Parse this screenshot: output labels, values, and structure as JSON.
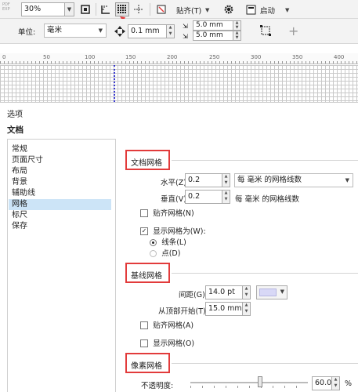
{
  "toolbar1": {
    "zoom_value": "30%",
    "snap_label": "贴齐(T)",
    "launch_label": "启动"
  },
  "toolbar2": {
    "unit_label": "单位:",
    "unit_value": "毫米",
    "nudge_value": "0.1 mm",
    "dup_h_value": "5.0 mm",
    "dup_v_value": "5.0 mm",
    "add_symbol": "+"
  },
  "ruler": {
    "ticks": [
      "0",
      "50",
      "100",
      "150",
      "200",
      "250",
      "300",
      "350",
      "400"
    ]
  },
  "dialog": {
    "title": "选项",
    "section": "文档"
  },
  "tree": {
    "items": [
      "常规",
      "页面尺寸",
      "布局",
      "背景",
      "辅助线",
      "网格",
      "标尺",
      "保存"
    ],
    "selected": "网格"
  },
  "document_grid": {
    "heading": "文档网格",
    "h_label": "水平(Z):",
    "h_value": "0.2",
    "h_mode": "每 毫米 的网格线数",
    "v_label": "垂直(V):",
    "v_value": "0.2",
    "v_mode": "每 毫米 的网格线数",
    "snap_label": "贴齐网格(N)",
    "show_label": "显示网格为(W):",
    "opt_lines": "线条(L)",
    "opt_dots": "点(D)"
  },
  "baseline_grid": {
    "heading": "基线网格",
    "spacing_label": "间距(G):",
    "spacing_value": "14.0 pt",
    "start_label": "从顶部开始(T):",
    "start_value": "15.0 mm",
    "snap_label": "贴齐网格(A)",
    "show_label": "显示网格(O)",
    "color": "#d8d8f6"
  },
  "pixel_grid": {
    "heading": "像素网格",
    "opacity_label": "不透明度:",
    "opacity_value": "60.0",
    "opacity_unit": "%"
  },
  "colors": {
    "highlight_red": "#e23b3b",
    "selection_blue": "#cce4f7"
  }
}
